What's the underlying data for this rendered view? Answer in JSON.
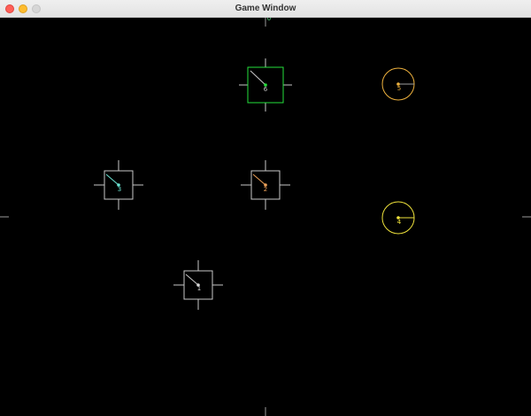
{
  "window": {
    "title": "Game Window",
    "background": "#000000",
    "top_marker_label": "0"
  },
  "controls": {
    "close_icon": "close-icon",
    "minimize_icon": "minimize-icon",
    "zoom_icon": "zoom-icon"
  },
  "entities": [
    {
      "id": "1",
      "shape": "square",
      "heading_icon": "heading-line-icon",
      "frame_color": "#c8c8c8",
      "pointer_color": "#c8c8c8",
      "label_color": "#d7d7d7",
      "center_color": "#d7d7d7"
    },
    {
      "id": "2",
      "shape": "square",
      "heading_icon": "heading-line-icon",
      "frame_color": "#c8c8c8",
      "pointer_color": "#f0a35a",
      "label_color": "#f0a35a",
      "center_color": "#f0a35a"
    },
    {
      "id": "3",
      "shape": "square",
      "heading_icon": "heading-line-icon",
      "frame_color": "#c8c8c8",
      "pointer_color": "#6ee8d7",
      "label_color": "#6ee8d7",
      "center_color": "#6ee8d7"
    },
    {
      "id": "4",
      "shape": "circle",
      "heading_icon": "heading-line-icon",
      "frame_color": "#f0e33b",
      "pointer_color": "#f0e33b",
      "label_color": "#f0e33b",
      "center_color": "#f0e33b"
    },
    {
      "id": "5",
      "shape": "circle",
      "heading_icon": "heading-line-icon",
      "frame_color": "#f0b33e",
      "pointer_color": "#a0a0a0",
      "label_color": "#f0b33e",
      "center_color": "#f0b33e"
    },
    {
      "id": "6",
      "shape": "square",
      "heading_icon": "heading-line-icon",
      "frame_color": "#25e13b",
      "pointer_color": "#c8c8c8",
      "label_color": "#c8c8c8",
      "center_color": "#25e13b"
    }
  ]
}
